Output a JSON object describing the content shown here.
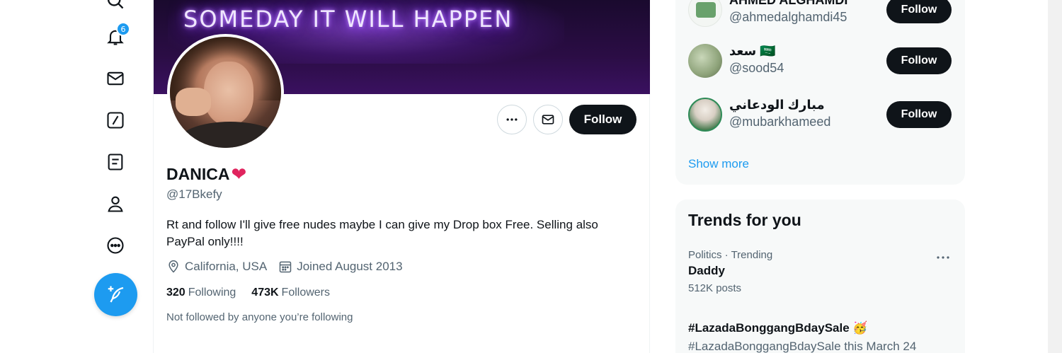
{
  "nav": {
    "notification_count": "6",
    "items": [
      "explore-icon",
      "notifications-icon",
      "messages-icon",
      "grok-icon",
      "lists-icon",
      "profile-icon",
      "more-icon"
    ],
    "compose_icon": "compose-icon"
  },
  "profile": {
    "banner_text": "SOMEDAY IT WILL HAPPEN",
    "display_name": "DANICA",
    "heart": "❤",
    "handle": "@17Bkefy",
    "bio": "Rt and follow I'll give free nudes maybe I can give my Drop box Free. Selling also PayPal only!!!!",
    "location": "California, USA",
    "joined": "Joined August 2013",
    "following_count": "320",
    "following_label": "Following",
    "followers_count": "473K",
    "followers_label": "Followers",
    "not_followed": "Not followed by anyone you’re following",
    "follow_label": "Follow"
  },
  "who_to_follow": {
    "items": [
      {
        "name": "AHMED ALGHAMDI",
        "handle": "@ahmedalghamdi45",
        "button": "Follow"
      },
      {
        "name": "سعد 🇸🇦",
        "handle": "@sood54",
        "button": "Follow"
      },
      {
        "name": "مبارك الودعاني",
        "handle": "@mubarkhameed",
        "button": "Follow"
      }
    ],
    "show_more": "Show more"
  },
  "trends": {
    "title": "Trends for you",
    "items": [
      {
        "context": "Politics · Trending",
        "title": "Daddy",
        "posts": "512K posts"
      },
      {
        "context": "",
        "title": "#LazadaBonggangBdaySale 🥳",
        "posts": "#LazadaBonggangBdaySale this March 24"
      }
    ]
  },
  "colors": {
    "accent": "#1d9bf0",
    "text": "#0f1419",
    "muted": "#536471",
    "button_dark": "#0f1419"
  }
}
